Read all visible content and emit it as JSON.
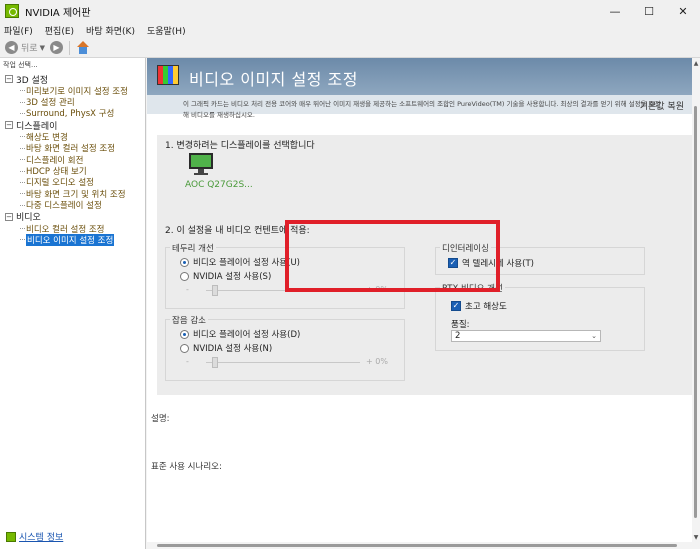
{
  "window": {
    "title": "NVIDIA 제어판",
    "minimize": "—",
    "maximize": "☐",
    "close": "✕"
  },
  "menu": [
    "파일(F)",
    "편집(E)",
    "바탕 화면(K)",
    "도움말(H)"
  ],
  "toolbar": {
    "back_label": "뒤로"
  },
  "task_panel": {
    "header": "작업 선택...",
    "categories": [
      {
        "label": "3D 설정",
        "items": [
          "미리보기로 이미지 설정 조정",
          "3D 설정 관리",
          "Surround, PhysX 구성"
        ]
      },
      {
        "label": "디스플레이",
        "items": [
          "해상도 변경",
          "바탕 화면 컬러 설정 조정",
          "디스플레이 회전",
          "HDCP 상태 보기",
          "디지털 오디오 설정",
          "바탕 화면 크기 및 위치 조정",
          "다중 디스플레이 설정"
        ]
      },
      {
        "label": "비디오",
        "items": [
          "비디오 컬러 설정 조정",
          "비디오 이미지 설정 조정"
        ]
      }
    ],
    "selected_item": "비디오 이미지 설정 조정",
    "system_info": "시스템 정보"
  },
  "page": {
    "title": "비디오 이미지 설정 조정",
    "restore": "기본값 복원",
    "intro_line1": "이 그래픽 카드는 비디오 처리 전용 코어와 매우 뛰어난 이미지 재생을 제공하는 소프트웨어의 조합인 PureVideo(TM) 기술을 사용합니다. 최상의 결과를 얻기 위해 설정을 조정",
    "intro_line2": "해 비디오를 재생하십시오."
  },
  "section1": {
    "title": "1. 변경하려는 디스플레이를 선택합니다",
    "display_name": "AOC Q27G2S..."
  },
  "section2": {
    "title": "2. 이 설정을 내 비디오 컨텐트에 적용:",
    "edge": {
      "title": "테두리 개선",
      "option_player": "비디오 플레이어 설정 사용(U)",
      "option_nvidia": "NVIDIA 설정 사용(S)",
      "slider_minus": "-",
      "slider_plus": "+ 0%",
      "selected": "player"
    },
    "noise": {
      "title": "잡음 감소",
      "option_player": "비디오 플레이어 설정 사용(D)",
      "option_nvidia": "NVIDIA 설정 사용(N)",
      "slider_minus": "-",
      "slider_plus": "+ 0%",
      "selected": "player"
    },
    "deinterlace": {
      "title": "디인터레이싱",
      "checkbox_label": "역 텔레시네 사용(T)",
      "checked": true
    },
    "rtx": {
      "title": "RTX 비디오 개선",
      "checkbox_label": "초고 해상도",
      "checked": true,
      "quality_label": "품질:",
      "quality_value": "2"
    }
  },
  "footer": {
    "description_label": "설명:",
    "usage_label": "표준 사용 시나리오:"
  },
  "colors": {
    "highlight": "#e01f29",
    "banner": "#7b97b3",
    "nvidia_green": "#76b900",
    "selection": "#1a74d2"
  }
}
